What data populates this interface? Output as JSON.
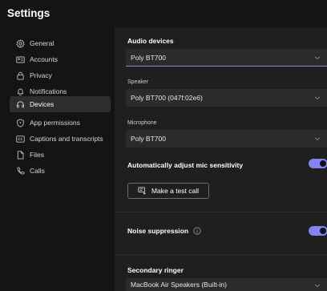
{
  "window": {
    "title": "Settings"
  },
  "sidebar": {
    "items": [
      {
        "label": "General",
        "icon": "gear-icon"
      },
      {
        "label": "Accounts",
        "icon": "accounts-card-icon"
      },
      {
        "label": "Privacy",
        "icon": "lock-icon"
      },
      {
        "label": "Notifications",
        "icon": "bell-icon"
      },
      {
        "label": "Devices",
        "icon": "headset-icon",
        "active": true
      },
      {
        "label": "App permissions",
        "icon": "shield-icon"
      },
      {
        "label": "Captions and transcripts",
        "icon": "captions-icon"
      },
      {
        "label": "Files",
        "icon": "file-icon"
      },
      {
        "label": "Calls",
        "icon": "phone-icon"
      }
    ]
  },
  "devices": {
    "audio_devices": {
      "heading": "Audio devices",
      "value": "Poly BT700"
    },
    "speaker": {
      "label": "Speaker",
      "value": "Poly BT700 (047f:02e6)"
    },
    "microphone": {
      "label": "Microphone",
      "value": "Poly BT700"
    },
    "auto_adjust": {
      "label": "Automatically adjust mic sensitivity",
      "enabled": true
    },
    "test_call": {
      "label": "Make a test call",
      "icon": "test-call-icon"
    },
    "noise_suppression": {
      "label": "Noise suppression",
      "enabled": true,
      "icon": "info-icon"
    },
    "secondary_ringer": {
      "heading": "Secondary ringer",
      "value": "MacBook Air Speakers (Built-in)"
    }
  },
  "colors": {
    "accent": "#7f85f5",
    "sidebar_bg": "#141414",
    "content_bg": "#1f1f1f",
    "dropdown_bg": "#2b2b2b",
    "active_item_bg": "#2e2e2e"
  }
}
